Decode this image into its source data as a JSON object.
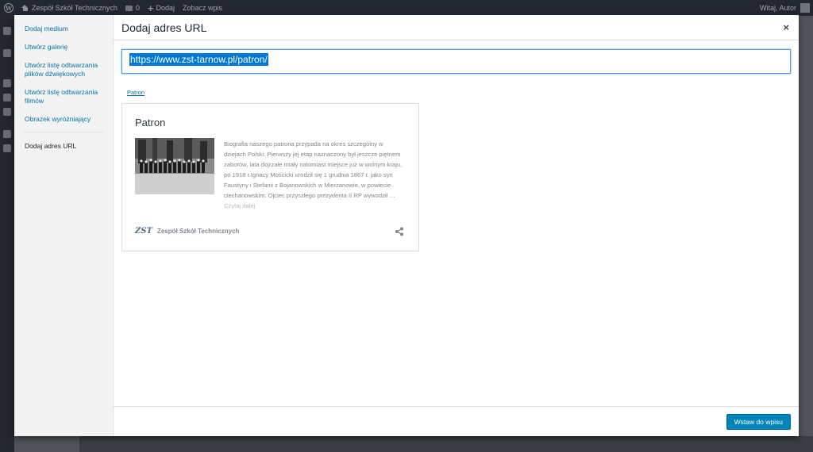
{
  "adminbar": {
    "site_name": "Zespół Szkół Technicznych",
    "comments_count": "0",
    "new_label": "Dodaj",
    "view_post_label": "Zobacz wpis",
    "greeting": "Witaj, Autor"
  },
  "media_menu": {
    "items": [
      {
        "label": "Dodaj medium"
      },
      {
        "label": "Utwórz galerię"
      },
      {
        "label": "Utwórz listę odtwarzania plików dźwiękowych"
      },
      {
        "label": "Utwórz listę odtwarzania filmów"
      },
      {
        "label": "Obrazek wyróżniający"
      }
    ],
    "active_item": "Dodaj adres URL"
  },
  "modal": {
    "title": "Dodaj adres URL",
    "close_symbol": "×"
  },
  "url_input": {
    "value": "https://www.zst-tarnow.pl/patron/"
  },
  "preview": {
    "link_label": "Patron",
    "card_title": "Patron",
    "excerpt": "Biografia naszego patrona przypada na okres szczególny w dziejach Polski. Pierwszy jej etap naznaczony był jeszcze piętnem zaborów, lata dojrzałe miały natomiast miejsce już w wolnym kraju, po 1918 r.Ignacy Mościcki urodził się 1 grudnia 1867 r. jako syn Faustyny i Stefanii z Bojanowskich w Mierzanowie, w powiecie ciechanowskim. Ojciec przyszłego prezydenta II RP wywodził …",
    "read_more": "Czytaj dalej",
    "site_logo": "ZST",
    "site_name": "Zespół Szkół Technicznych"
  },
  "footer": {
    "insert_label": "Wstaw do wpisu"
  }
}
